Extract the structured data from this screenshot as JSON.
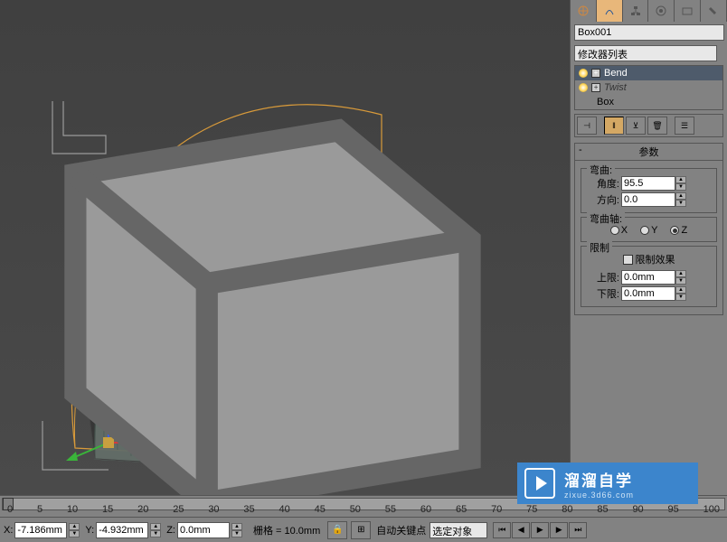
{
  "object_name": "Box001",
  "modifier_list_label": "修改器列表",
  "stack": {
    "bend": "Bend",
    "twist": "Twist",
    "box": "Box"
  },
  "rollup": {
    "title": "参数",
    "bend_group": "弯曲:",
    "angle_label": "角度:",
    "angle_value": "95.5",
    "direction_label": "方向:",
    "direction_value": "0.0",
    "axis_group": "弯曲轴:",
    "axis_x": "X",
    "axis_y": "Y",
    "axis_z": "Z",
    "limit_group": "限制",
    "limit_effect": "限制效果",
    "upper_label": "上限:",
    "upper_value": "0.0mm",
    "lower_label": "下限:",
    "lower_value": "0.0mm"
  },
  "ticks": [
    "0",
    "5",
    "10",
    "15",
    "20",
    "25",
    "30",
    "35",
    "40",
    "45",
    "50",
    "55",
    "60",
    "65",
    "70",
    "75",
    "80",
    "85",
    "90",
    "95",
    "100"
  ],
  "status": {
    "x_label": "X:",
    "x_value": "-7.186mm",
    "y_label": "Y:",
    "y_value": "-4.932mm",
    "z_label": "Z:",
    "z_value": "0.0mm",
    "grid": "栅格 = 10.0mm",
    "auto_key": "自动关键点",
    "select_obj": "选定对象"
  },
  "watermark": {
    "main": "溜溜自学",
    "sub": "zixue.3d66.com"
  }
}
